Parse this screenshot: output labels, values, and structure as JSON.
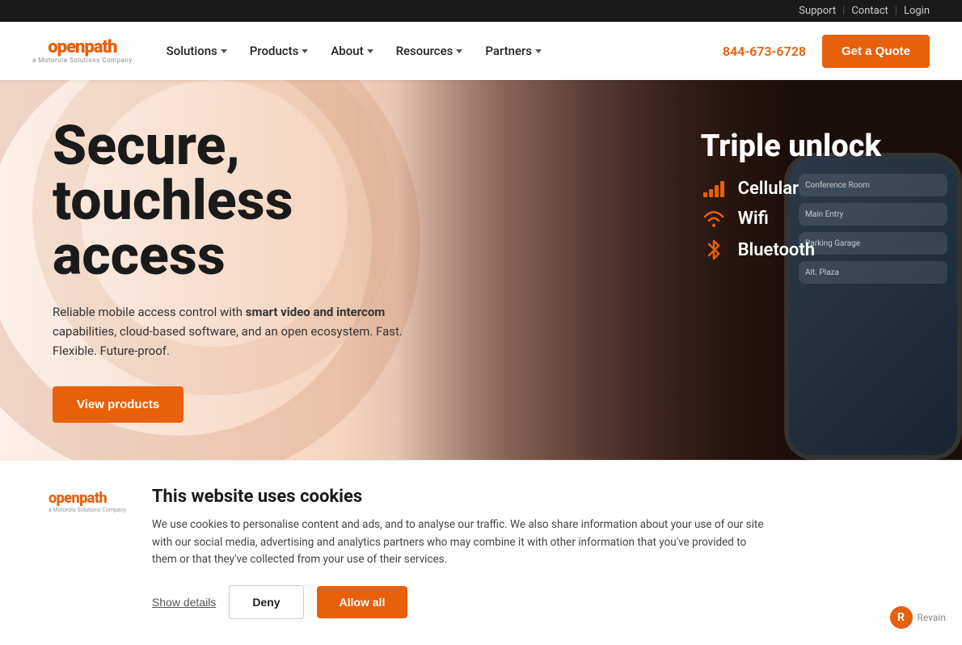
{
  "topbar": {
    "support_label": "Support",
    "contact_label": "Contact",
    "login_label": "Login"
  },
  "nav": {
    "logo_main": "openpath",
    "logo_sub": "a Motorola Solutions Company",
    "solutions_label": "Solutions",
    "products_label": "Products",
    "about_label": "About",
    "resources_label": "Resources",
    "partners_label": "Partners",
    "phone": "844-673-6728",
    "cta_label": "Get a Quote"
  },
  "hero": {
    "title_line1": "Secure,",
    "title_line2": "touchless",
    "title_line3": "access",
    "subtitle": "Reliable mobile access control with smart video and intercom capabilities, cloud-based software, and an open ecosystem. Fast. Flexible. Future-proof.",
    "subtitle_bold": "smart video and intercom",
    "cta_label": "View products",
    "triple_unlock_title": "Triple unlock",
    "unlock_1": "Cellular",
    "unlock_2": "Wifi",
    "unlock_3": "Bluetooth"
  },
  "cookie": {
    "title": "This website uses cookies",
    "body": "We use cookies to personalise content and ads, and to analyse our traffic. We also share information about your use of our site with our social media, advertising and analytics partners who may combine it with other information that you've provided to them or that they've collected from your use of their services.",
    "show_details_label": "Show details",
    "deny_label": "Deny",
    "allow_label": "Allow all"
  },
  "revain": {
    "label": "Revain"
  }
}
